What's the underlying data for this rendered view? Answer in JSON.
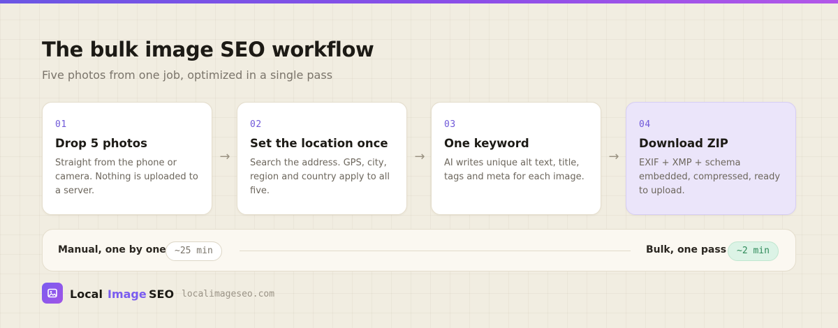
{
  "header": {
    "title": "The bulk image SEO workflow",
    "subtitle": "Five photos from one job, optimized in a single pass"
  },
  "steps": [
    {
      "number": "01",
      "title": "Drop 5 photos",
      "description": "Straight from the phone or camera. Nothing is uploaded to a server."
    },
    {
      "number": "02",
      "title": "Set the location once",
      "description": "Search the address. GPS, city, region and country apply to all five."
    },
    {
      "number": "03",
      "title": "One keyword",
      "description": "AI writes unique alt text, title, tags and meta for each image."
    },
    {
      "number": "04",
      "title": "Download ZIP",
      "description": "EXIF + XMP + schema embedded, compressed, ready to upload."
    }
  ],
  "arrow_glyph": "→",
  "comparison": {
    "manual_label": "Manual, one by one",
    "manual_time": "~25 min",
    "bulk_label": "Bulk, one pass",
    "bulk_time": "~2 min"
  },
  "footer": {
    "logo_icon": "image-icon",
    "brand_part1": "Local",
    "brand_part2": "Image",
    "brand_part3": "SEO",
    "url": "localimageseo.com"
  },
  "colors": {
    "accent": "#6f58d9",
    "background": "#f1ede1",
    "active_card": "#ebe5fa",
    "success": "#2f8a5a"
  }
}
